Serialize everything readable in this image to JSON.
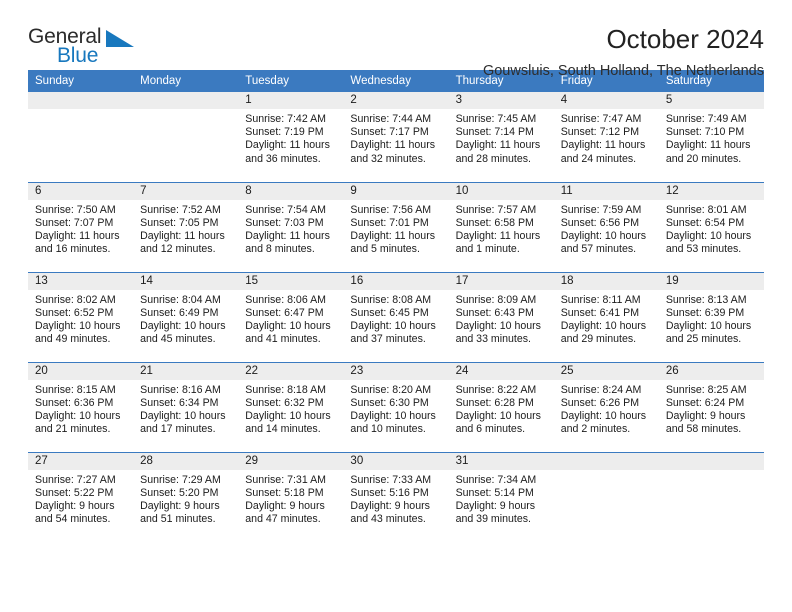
{
  "brand": {
    "word_one": "General",
    "word_two": "Blue"
  },
  "header": {
    "title": "October 2024",
    "location": "Gouwsluis, South Holland, The Netherlands"
  },
  "colors": {
    "header_blue": "#3b7ac0",
    "brand_blue": "#1878be",
    "daynum_band": "#ededed"
  },
  "weekday_headers": [
    "Sunday",
    "Monday",
    "Tuesday",
    "Wednesday",
    "Thursday",
    "Friday",
    "Saturday"
  ],
  "weeks": [
    [
      {
        "day": "",
        "sunrise": "",
        "sunset": "",
        "daylight_line1": "",
        "daylight_line2": "",
        "blank": true
      },
      {
        "day": "",
        "sunrise": "",
        "sunset": "",
        "daylight_line1": "",
        "daylight_line2": "",
        "blank": true
      },
      {
        "day": "1",
        "sunrise": "Sunrise: 7:42 AM",
        "sunset": "Sunset: 7:19 PM",
        "daylight_line1": "Daylight: 11 hours",
        "daylight_line2": "and 36 minutes."
      },
      {
        "day": "2",
        "sunrise": "Sunrise: 7:44 AM",
        "sunset": "Sunset: 7:17 PM",
        "daylight_line1": "Daylight: 11 hours",
        "daylight_line2": "and 32 minutes."
      },
      {
        "day": "3",
        "sunrise": "Sunrise: 7:45 AM",
        "sunset": "Sunset: 7:14 PM",
        "daylight_line1": "Daylight: 11 hours",
        "daylight_line2": "and 28 minutes."
      },
      {
        "day": "4",
        "sunrise": "Sunrise: 7:47 AM",
        "sunset": "Sunset: 7:12 PM",
        "daylight_line1": "Daylight: 11 hours",
        "daylight_line2": "and 24 minutes."
      },
      {
        "day": "5",
        "sunrise": "Sunrise: 7:49 AM",
        "sunset": "Sunset: 7:10 PM",
        "daylight_line1": "Daylight: 11 hours",
        "daylight_line2": "and 20 minutes."
      }
    ],
    [
      {
        "day": "6",
        "sunrise": "Sunrise: 7:50 AM",
        "sunset": "Sunset: 7:07 PM",
        "daylight_line1": "Daylight: 11 hours",
        "daylight_line2": "and 16 minutes."
      },
      {
        "day": "7",
        "sunrise": "Sunrise: 7:52 AM",
        "sunset": "Sunset: 7:05 PM",
        "daylight_line1": "Daylight: 11 hours",
        "daylight_line2": "and 12 minutes."
      },
      {
        "day": "8",
        "sunrise": "Sunrise: 7:54 AM",
        "sunset": "Sunset: 7:03 PM",
        "daylight_line1": "Daylight: 11 hours",
        "daylight_line2": "and 8 minutes."
      },
      {
        "day": "9",
        "sunrise": "Sunrise: 7:56 AM",
        "sunset": "Sunset: 7:01 PM",
        "daylight_line1": "Daylight: 11 hours",
        "daylight_line2": "and 5 minutes."
      },
      {
        "day": "10",
        "sunrise": "Sunrise: 7:57 AM",
        "sunset": "Sunset: 6:58 PM",
        "daylight_line1": "Daylight: 11 hours",
        "daylight_line2": "and 1 minute."
      },
      {
        "day": "11",
        "sunrise": "Sunrise: 7:59 AM",
        "sunset": "Sunset: 6:56 PM",
        "daylight_line1": "Daylight: 10 hours",
        "daylight_line2": "and 57 minutes."
      },
      {
        "day": "12",
        "sunrise": "Sunrise: 8:01 AM",
        "sunset": "Sunset: 6:54 PM",
        "daylight_line1": "Daylight: 10 hours",
        "daylight_line2": "and 53 minutes."
      }
    ],
    [
      {
        "day": "13",
        "sunrise": "Sunrise: 8:02 AM",
        "sunset": "Sunset: 6:52 PM",
        "daylight_line1": "Daylight: 10 hours",
        "daylight_line2": "and 49 minutes."
      },
      {
        "day": "14",
        "sunrise": "Sunrise: 8:04 AM",
        "sunset": "Sunset: 6:49 PM",
        "daylight_line1": "Daylight: 10 hours",
        "daylight_line2": "and 45 minutes."
      },
      {
        "day": "15",
        "sunrise": "Sunrise: 8:06 AM",
        "sunset": "Sunset: 6:47 PM",
        "daylight_line1": "Daylight: 10 hours",
        "daylight_line2": "and 41 minutes."
      },
      {
        "day": "16",
        "sunrise": "Sunrise: 8:08 AM",
        "sunset": "Sunset: 6:45 PM",
        "daylight_line1": "Daylight: 10 hours",
        "daylight_line2": "and 37 minutes."
      },
      {
        "day": "17",
        "sunrise": "Sunrise: 8:09 AM",
        "sunset": "Sunset: 6:43 PM",
        "daylight_line1": "Daylight: 10 hours",
        "daylight_line2": "and 33 minutes."
      },
      {
        "day": "18",
        "sunrise": "Sunrise: 8:11 AM",
        "sunset": "Sunset: 6:41 PM",
        "daylight_line1": "Daylight: 10 hours",
        "daylight_line2": "and 29 minutes."
      },
      {
        "day": "19",
        "sunrise": "Sunrise: 8:13 AM",
        "sunset": "Sunset: 6:39 PM",
        "daylight_line1": "Daylight: 10 hours",
        "daylight_line2": "and 25 minutes."
      }
    ],
    [
      {
        "day": "20",
        "sunrise": "Sunrise: 8:15 AM",
        "sunset": "Sunset: 6:36 PM",
        "daylight_line1": "Daylight: 10 hours",
        "daylight_line2": "and 21 minutes."
      },
      {
        "day": "21",
        "sunrise": "Sunrise: 8:16 AM",
        "sunset": "Sunset: 6:34 PM",
        "daylight_line1": "Daylight: 10 hours",
        "daylight_line2": "and 17 minutes."
      },
      {
        "day": "22",
        "sunrise": "Sunrise: 8:18 AM",
        "sunset": "Sunset: 6:32 PM",
        "daylight_line1": "Daylight: 10 hours",
        "daylight_line2": "and 14 minutes."
      },
      {
        "day": "23",
        "sunrise": "Sunrise: 8:20 AM",
        "sunset": "Sunset: 6:30 PM",
        "daylight_line1": "Daylight: 10 hours",
        "daylight_line2": "and 10 minutes."
      },
      {
        "day": "24",
        "sunrise": "Sunrise: 8:22 AM",
        "sunset": "Sunset: 6:28 PM",
        "daylight_line1": "Daylight: 10 hours",
        "daylight_line2": "and 6 minutes."
      },
      {
        "day": "25",
        "sunrise": "Sunrise: 8:24 AM",
        "sunset": "Sunset: 6:26 PM",
        "daylight_line1": "Daylight: 10 hours",
        "daylight_line2": "and 2 minutes."
      },
      {
        "day": "26",
        "sunrise": "Sunrise: 8:25 AM",
        "sunset": "Sunset: 6:24 PM",
        "daylight_line1": "Daylight: 9 hours",
        "daylight_line2": "and 58 minutes."
      }
    ],
    [
      {
        "day": "27",
        "sunrise": "Sunrise: 7:27 AM",
        "sunset": "Sunset: 5:22 PM",
        "daylight_line1": "Daylight: 9 hours",
        "daylight_line2": "and 54 minutes."
      },
      {
        "day": "28",
        "sunrise": "Sunrise: 7:29 AM",
        "sunset": "Sunset: 5:20 PM",
        "daylight_line1": "Daylight: 9 hours",
        "daylight_line2": "and 51 minutes."
      },
      {
        "day": "29",
        "sunrise": "Sunrise: 7:31 AM",
        "sunset": "Sunset: 5:18 PM",
        "daylight_line1": "Daylight: 9 hours",
        "daylight_line2": "and 47 minutes."
      },
      {
        "day": "30",
        "sunrise": "Sunrise: 7:33 AM",
        "sunset": "Sunset: 5:16 PM",
        "daylight_line1": "Daylight: 9 hours",
        "daylight_line2": "and 43 minutes."
      },
      {
        "day": "31",
        "sunrise": "Sunrise: 7:34 AM",
        "sunset": "Sunset: 5:14 PM",
        "daylight_line1": "Daylight: 9 hours",
        "daylight_line2": "and 39 minutes."
      },
      {
        "day": "",
        "sunrise": "",
        "sunset": "",
        "daylight_line1": "",
        "daylight_line2": "",
        "blank": true
      },
      {
        "day": "",
        "sunrise": "",
        "sunset": "",
        "daylight_line1": "",
        "daylight_line2": "",
        "blank": true
      }
    ]
  ]
}
